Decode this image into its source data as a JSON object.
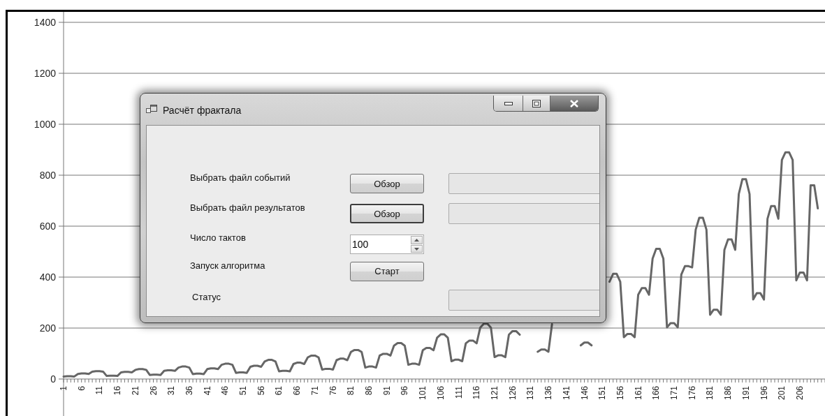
{
  "chart": {
    "chart_data": {
      "type": "line",
      "grid": true,
      "ylim": [
        0,
        1400
      ],
      "yticks": [
        0,
        200,
        400,
        600,
        800,
        1000,
        1200,
        1400
      ],
      "xlim": [
        1,
        213
      ],
      "x": [
        1,
        2,
        3,
        4,
        5,
        6,
        7,
        8,
        9,
        10,
        11,
        12,
        13,
        14,
        15,
        16,
        17,
        18,
        19,
        20,
        21,
        22,
        23,
        24,
        25,
        26,
        27,
        28,
        29,
        30,
        31,
        32,
        33,
        34,
        35,
        36,
        37,
        38,
        39,
        40,
        41,
        42,
        43,
        44,
        45,
        46,
        47,
        48,
        49,
        50,
        51,
        52,
        53,
        54,
        55,
        56,
        57,
        58,
        59,
        60,
        61,
        62,
        63,
        64,
        65,
        66,
        67,
        68,
        69,
        70,
        71,
        72,
        73,
        74,
        75,
        76,
        77,
        78,
        79,
        80,
        81,
        82,
        83,
        84,
        85,
        86,
        87,
        88,
        89,
        90,
        91,
        92,
        93,
        94,
        95,
        96,
        97,
        98,
        99,
        100,
        101,
        102,
        103,
        104,
        105,
        106,
        107,
        108,
        109,
        110,
        111,
        112,
        113,
        114,
        115,
        116,
        117,
        118,
        119,
        120,
        121,
        122,
        123,
        124,
        125,
        126,
        127,
        128,
        129,
        130,
        131,
        132,
        133,
        134,
        135,
        136,
        137,
        138,
        139,
        140,
        141,
        142,
        143,
        144,
        145,
        146,
        147,
        148,
        149,
        150,
        151,
        152,
        153,
        154,
        155,
        156,
        157,
        158,
        159,
        160,
        161,
        162,
        163,
        164,
        165,
        166,
        167,
        168,
        169,
        170,
        171,
        172,
        173,
        174,
        175,
        176,
        177,
        178,
        179,
        180,
        181,
        182,
        183,
        184,
        185,
        186,
        187,
        188,
        189,
        190,
        191,
        192,
        193,
        194,
        195,
        196,
        197,
        198,
        199,
        200,
        201,
        202,
        203,
        204,
        205,
        206,
        207,
        208,
        209,
        210,
        211
      ],
      "xticks": [
        1,
        6,
        11,
        16,
        21,
        26,
        31,
        36,
        41,
        46,
        51,
        56,
        61,
        66,
        71,
        76,
        81,
        86,
        91,
        96,
        101,
        106,
        111,
        116,
        121,
        126,
        131,
        136,
        141,
        146,
        151,
        156,
        161,
        166,
        171,
        176,
        181,
        186,
        191,
        196,
        201,
        206
      ],
      "series": [
        {
          "color": "#666666",
          "values": [
            10,
            11,
            11,
            10,
            20,
            22,
            22,
            20,
            29,
            31,
            31,
            29,
            12,
            13,
            13,
            12,
            26,
            28,
            28,
            26,
            36,
            39,
            39,
            36,
            16,
            17,
            17,
            16,
            32,
            34,
            34,
            32,
            45,
            49,
            49,
            45,
            19,
            21,
            21,
            19,
            39,
            42,
            42,
            39,
            56,
            60,
            60,
            56,
            24,
            26,
            26,
            24,
            48,
            52,
            52,
            48,
            69,
            75,
            75,
            69,
            30,
            32,
            32,
            30,
            59,
            64,
            64,
            59,
            85,
            92,
            92,
            85,
            37,
            40,
            40,
            37,
            74,
            80,
            80,
            74,
            106,
            114,
            114,
            106,
            45,
            49,
            49,
            45,
            92,
            99,
            99,
            92,
            131,
            141,
            141,
            131,
            56,
            60,
            60,
            56,
            113,
            122,
            122,
            113,
            162,
            175,
            175,
            162,
            70,
            76,
            76,
            70,
            140,
            151,
            151,
            140,
            201,
            217,
            217,
            201,
            86,
            93,
            93,
            86,
            174,
            188,
            188,
            174,
            null,
            null,
            null,
            null,
            107,
            116,
            116,
            107,
            215,
            null,
            null,
            null,
            null,
            null,
            null,
            null,
            132,
            143,
            143,
            132,
            null,
            null,
            null,
            null,
            382,
            413,
            413,
            382,
            164,
            177,
            177,
            164,
            331,
            357,
            357,
            331,
            473,
            511,
            511,
            473,
            203,
            219,
            219,
            203,
            410,
            443,
            443,
            438,
            586,
            633,
            633,
            586,
            252,
            272,
            272,
            252,
            507,
            548,
            548,
            507,
            726,
            784,
            784,
            726,
            312,
            337,
            337,
            312,
            629,
            679,
            679,
            629,
            860,
            890,
            890,
            860,
            387,
            418,
            418,
            387,
            760,
            760,
            670
          ]
        }
      ]
    }
  },
  "dialog": {
    "title": "Расчёт фрактала",
    "rows": [
      {
        "kind": "browse",
        "label": "Выбрать файл событий",
        "button": "Обзор",
        "focused": false
      },
      {
        "kind": "browse",
        "label": "Выбрать файл результатов",
        "button": "Обзор",
        "focused": true
      },
      {
        "kind": "number",
        "label": "Число тактов",
        "value": "100"
      },
      {
        "kind": "action",
        "label": "Запуск алгоритма",
        "button": "Старт"
      },
      {
        "kind": "status",
        "label": "Статус"
      }
    ]
  }
}
